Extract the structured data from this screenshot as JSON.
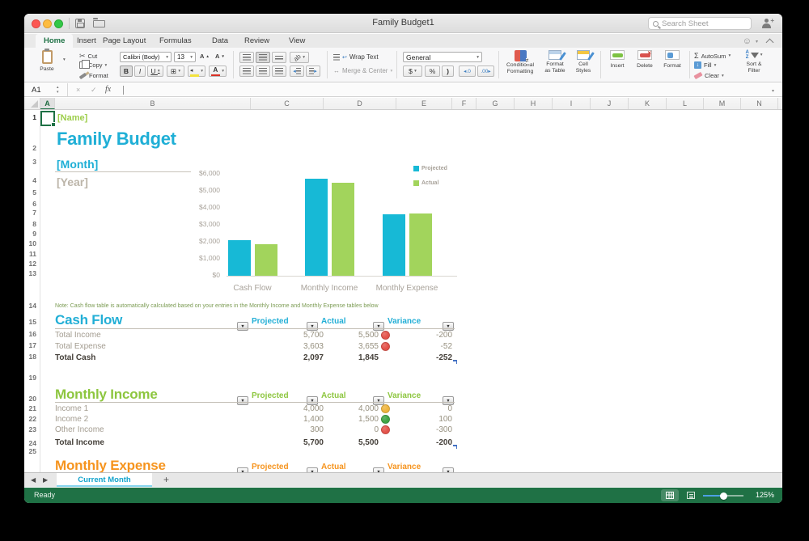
{
  "window": {
    "title": "Family Budget1"
  },
  "titlebar": {
    "search_placeholder": "Search Sheet"
  },
  "tabs": {
    "items": [
      "Home",
      "Insert",
      "Page Layout",
      "Formulas",
      "Data",
      "Review",
      "View"
    ],
    "active_index": 0
  },
  "ribbon": {
    "paste": "Paste",
    "cut": "Cut",
    "copy": "Copy",
    "format_painter": "Format",
    "font_name": "Calibri (Body)",
    "font_size": "13",
    "bold": "B",
    "italic": "I",
    "underline": "U",
    "font_glyph": "A",
    "border_glyph": "⊞",
    "wrap_text": "Wrap Text",
    "merge_center": "Merge & Center",
    "number_format": "General",
    "currency": "$",
    "percent": "%",
    "paren": ")",
    "dec_inc": "◂.0",
    "dec_dec": ".00▸",
    "conditional_1": "Conditional",
    "conditional_2": "Formatting",
    "format_table_1": "Format",
    "format_table_2": "as Table",
    "cell_styles_1": "Cell",
    "cell_styles_2": "Styles",
    "insert": "Insert",
    "delete": "Delete",
    "format_cells": "Format",
    "autosum": "AutoSum",
    "fill": "Fill",
    "clear": "Clear",
    "sort_1": "Sort &",
    "sort_2": "Filter",
    "az_a": "A",
    "az_z": "Z",
    "sum_glyph": "Σ",
    "fill_glyph": "↓",
    "delete_glyph": "×"
  },
  "formula_bar": {
    "name_box": "A1",
    "fx": "fx",
    "cancel": "×",
    "confirm": "✓"
  },
  "grid": {
    "columns": [
      "A",
      "B",
      "C",
      "D",
      "E",
      "F",
      "G",
      "H",
      "I",
      "J",
      "K",
      "L",
      "M",
      "N"
    ],
    "rows": [
      "1",
      "2",
      "3",
      "4",
      "5",
      "6",
      "7",
      "8",
      "9",
      "10",
      "11",
      "12",
      "13",
      "14",
      "15",
      "16",
      "17",
      "18",
      "19",
      "20",
      "21",
      "22",
      "23",
      "24",
      "25"
    ],
    "selected_column": "A",
    "selected_row": "1"
  },
  "sheet": {
    "name_cell": "[Name]",
    "title": "Family Budget",
    "month": "[Month]",
    "year": "[Year]",
    "note": "Note: Cash flow table is automatically calculated based on your entries in the Monthly Income and Monthly Expense tables below",
    "tables": [
      {
        "title": "Cash Flow",
        "color": "#23AFD6",
        "headers": [
          "Projected",
          "Actual",
          "Variance"
        ],
        "rows": [
          {
            "label": "Total Income",
            "projected": "5,700",
            "actual": "5,500",
            "indicator": "red",
            "variance": "-200",
            "bold": false
          },
          {
            "label": "Total Expense",
            "projected": "3,603",
            "actual": "3,655",
            "indicator": "red",
            "variance": "-52",
            "bold": false
          },
          {
            "label": "Total Cash",
            "projected": "2,097",
            "actual": "1,845",
            "indicator": null,
            "variance": "-252",
            "bold": true,
            "corner_mark": true
          }
        ]
      },
      {
        "title": "Monthly Income",
        "color": "#8DC63F",
        "headers": [
          "Projected",
          "Actual",
          "Variance"
        ],
        "rows": [
          {
            "label": "Income 1",
            "projected": "4,000",
            "actual": "4,000",
            "indicator": "amber",
            "variance": "0",
            "bold": false
          },
          {
            "label": "Income 2",
            "projected": "1,400",
            "actual": "1,500",
            "indicator": "green",
            "variance": "100",
            "bold": false
          },
          {
            "label": "Other Income",
            "projected": "300",
            "actual": "0",
            "indicator": "red",
            "variance": "-300",
            "bold": false
          },
          {
            "label": "Total Income",
            "projected": "5,700",
            "actual": "5,500",
            "indicator": null,
            "variance": "-200",
            "bold": true,
            "corner_mark": true
          }
        ]
      },
      {
        "title": "Monthly Expense",
        "color": "#F6941E",
        "headers": [
          "Projected",
          "Actual",
          "Variance"
        ],
        "rows": []
      }
    ]
  },
  "chart_data": {
    "type": "bar",
    "categories": [
      "Cash Flow",
      "Monthly Income",
      "Monthly Expense"
    ],
    "series": [
      {
        "name": "Projected",
        "color": "#17B9D6",
        "values": [
          2097,
          5700,
          3603
        ]
      },
      {
        "name": "Actual",
        "color": "#A2D45C",
        "values": [
          1845,
          5500,
          3655
        ]
      }
    ],
    "ylim": [
      0,
      6000
    ],
    "ytick_step": 1000,
    "ytick_labels": [
      "$0",
      "$1,000",
      "$2,000",
      "$3,000",
      "$4,000",
      "$5,000",
      "$6,000"
    ],
    "legend_position": "top-right",
    "grid": false
  },
  "colors": {
    "indicator_red": "#E4534B",
    "indicator_amber": "#EFB53E",
    "indicator_green": "#3FA445",
    "accent_cyan": "#23AFD6",
    "status_green": "#1F7145"
  },
  "sheet_tabs": {
    "active": "Current Month",
    "prev": "◀",
    "next": "▶",
    "add": "+"
  },
  "status_bar": {
    "status": "Ready",
    "zoom": "125%"
  }
}
